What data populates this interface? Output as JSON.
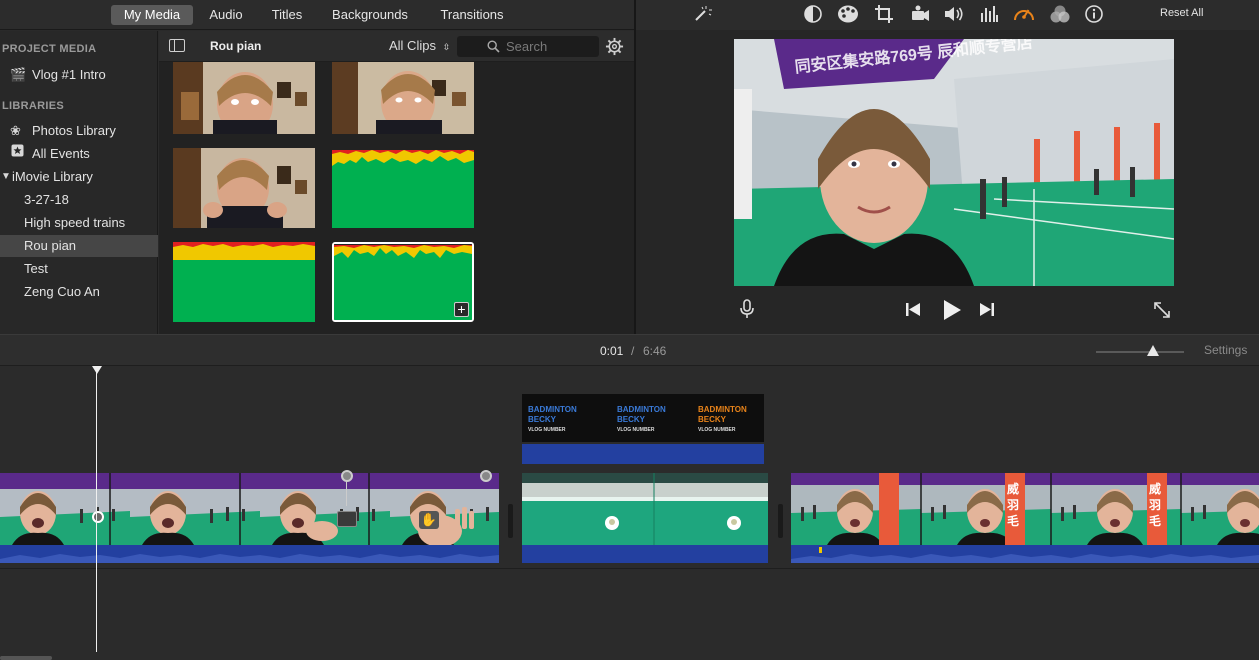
{
  "browser_tabs": [
    "My Media",
    "Audio",
    "Titles",
    "Backgrounds",
    "Transitions"
  ],
  "sidebar": {
    "project_media_heading": "PROJECT MEDIA",
    "project_item": "Vlog #1 Intro",
    "libraries_heading": "LIBRARIES",
    "photos_library": "Photos Library",
    "all_events": "All Events",
    "imovie_library": "iMovie Library",
    "events": [
      "3-27-18",
      "High speed trains",
      "Rou pian",
      "Test",
      "Zeng Cuo An"
    ],
    "selected_event": "Rou pian"
  },
  "browser": {
    "event_title": "Rou pian",
    "filter_label": "All Clips",
    "search_placeholder": "Search"
  },
  "viewer": {
    "reset_all_label": "Reset All",
    "tool_icons": [
      "magic-wand-icon",
      "color-balance-icon",
      "color-correction-icon",
      "crop-icon",
      "stabilization-icon",
      "volume-icon",
      "equalizer-icon",
      "speed-icon",
      "clip-filter-icon",
      "info-icon"
    ],
    "banner_text": "同安区集安路769号 辰和顺专营店"
  },
  "timeline": {
    "current_time": "0:01",
    "separator": "/",
    "total_time": "6:46",
    "settings_label": "Settings",
    "zoom_level": 0.65,
    "title_card_text": "BADMINTON BECKY",
    "title_card_subtext": "VLOG NUMBER",
    "banner_glyph": "威羽毛"
  },
  "colors": {
    "accent_selected_tab": "#5a5a5a",
    "clip_audio_blue": "#2340a0",
    "audio_green": "#00b050",
    "audio_yellow": "#f0c800",
    "audio_red": "#e02020",
    "speed_orange": "#e8831a"
  }
}
